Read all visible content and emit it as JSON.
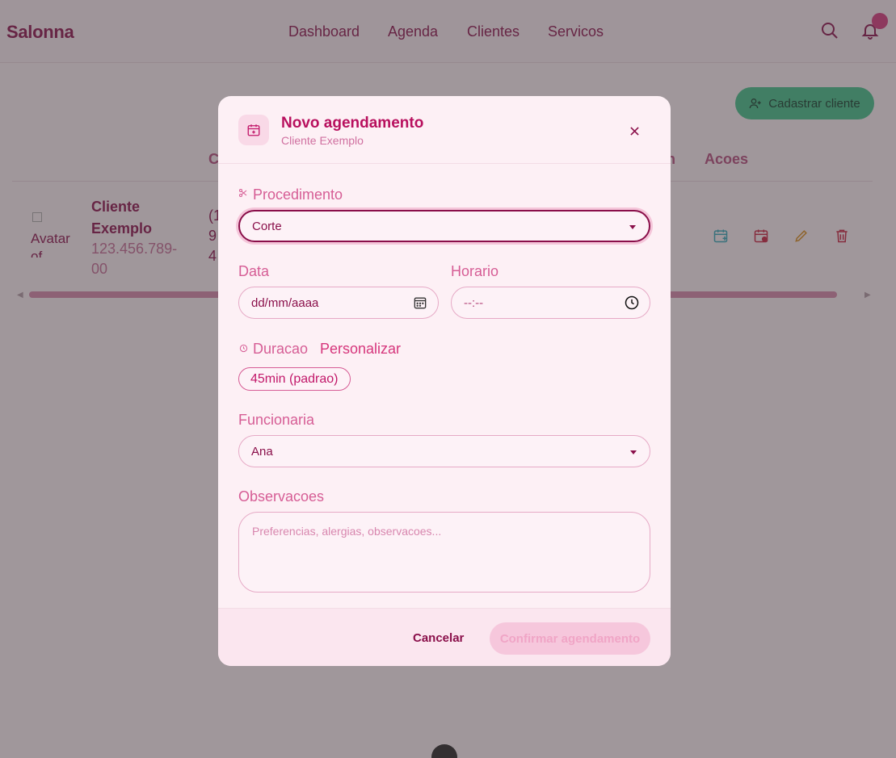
{
  "app": {
    "brand": "Salonna"
  },
  "nav": {
    "items": [
      {
        "label": "Dashboard"
      },
      {
        "label": "Agenda"
      },
      {
        "label": "Clientes"
      },
      {
        "label": "Servicos"
      }
    ]
  },
  "topbar": {
    "search_icon": "search-icon",
    "notification_icon": "bell-icon"
  },
  "page": {
    "add_client_label": "Cadastrar cliente",
    "table_headers": {
      "contact_partial": "C",
      "partial_n": "n",
      "actions": "Acoes"
    },
    "client_row": {
      "avatar_alt": "Avatar of",
      "name": "Cliente Exemplo",
      "cpf": "123.456.789-00",
      "phone_partial": "(1 9  4"
    }
  },
  "modal": {
    "title": "Novo agendamento",
    "subtitle": "Cliente Exemplo",
    "close_label": "×",
    "procedure": {
      "label": "Procedimento",
      "value": "Corte"
    },
    "date": {
      "label": "Data",
      "placeholder": "dd/mm/aaaa"
    },
    "time": {
      "label": "Horario",
      "placeholder": "--:--"
    },
    "duration": {
      "label": "Duracao",
      "customize": "Personalizar",
      "chip": "45min (padrao)"
    },
    "staff": {
      "label": "Funcionaria",
      "value": "Ana"
    },
    "notes": {
      "label": "Observacoes",
      "placeholder": "Preferencias, alergias, observacoes..."
    },
    "cancel_label": "Cancelar",
    "confirm_label": "Confirmar agendamento"
  },
  "colors": {
    "brand": "#8a0f4a",
    "accent": "#d6367c",
    "success": "#3ec088"
  }
}
